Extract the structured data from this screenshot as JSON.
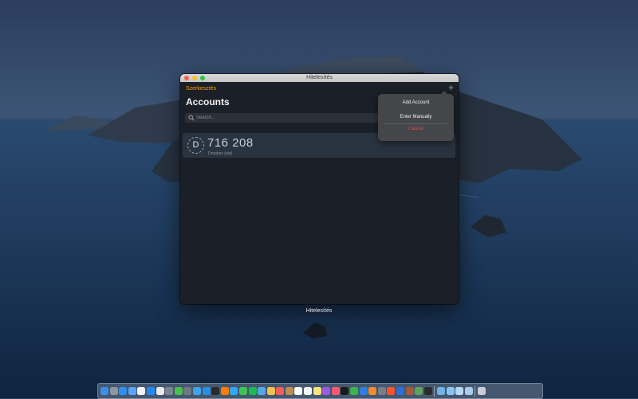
{
  "window": {
    "title": "Hitelesítés",
    "edit_label": "Szerkesztés",
    "add_symbol": "+",
    "heading": "Accounts",
    "search": {
      "placeholder": "Search..."
    },
    "accounts": [
      {
        "initial": "D",
        "code": "716 208",
        "name": "Dropbox (pie)"
      }
    ]
  },
  "popover": {
    "add_account": "Add Account",
    "enter_manually": "Enter Manually",
    "cancel": "Cancel"
  },
  "dock": {
    "hover_label": "Hitelesítés",
    "icons": [
      {
        "name": "finder-icon",
        "color": "#3b8fe8"
      },
      {
        "name": "launchpad-icon",
        "color": "#8d96a3"
      },
      {
        "name": "safari-icon",
        "color": "#2f8ef0"
      },
      {
        "name": "mail-icon",
        "color": "#5aa4f5"
      },
      {
        "name": "calendar-icon",
        "color": "#f2f2f2"
      },
      {
        "name": "app-store-icon",
        "color": "#1f8cf5"
      },
      {
        "name": "chrome-icon",
        "color": "#e9e9e9"
      },
      {
        "name": "system-preferences-icon",
        "color": "#7d8590"
      },
      {
        "name": "messages-green-icon",
        "color": "#48c04f"
      },
      {
        "name": "migration-icon",
        "color": "#6f7884"
      },
      {
        "name": "stickies-icon",
        "color": "#3ea6e8"
      },
      {
        "name": "preview-icon",
        "color": "#2d8de0"
      },
      {
        "name": "terminal-icon",
        "color": "#2a2a2a"
      },
      {
        "name": "illustrator-icon",
        "color": "#ff7c00"
      },
      {
        "name": "photoshop-icon",
        "color": "#31a8ff"
      },
      {
        "name": "facetime-icon",
        "color": "#3dc351"
      },
      {
        "name": "spotify-icon",
        "color": "#1db954"
      },
      {
        "name": "globe-icon",
        "color": "#58a6e6"
      },
      {
        "name": "photos-icon",
        "color": "#f0c14b"
      },
      {
        "name": "tinder-icon",
        "color": "#f05f5a"
      },
      {
        "name": "books-icon",
        "color": "#c28b4f"
      },
      {
        "name": "calendar-date-icon",
        "color": "#fafafa"
      },
      {
        "name": "notes-icon",
        "color": "#f5f5f5"
      },
      {
        "name": "stickies-yellow-icon",
        "color": "#f6e37a"
      },
      {
        "name": "podcasts-icon",
        "color": "#9a5be0"
      },
      {
        "name": "music-icon",
        "color": "#fa5a6e"
      },
      {
        "name": "tv-icon",
        "color": "#1b1b1b"
      },
      {
        "name": "numbers-icon",
        "color": "#39b54a"
      },
      {
        "name": "keynote-icon",
        "color": "#2f7fe0"
      },
      {
        "name": "pages-icon",
        "color": "#f08b2c"
      },
      {
        "name": "screenshot-icon",
        "color": "#7a7f87"
      },
      {
        "name": "brave-icon",
        "color": "#fb542b"
      },
      {
        "name": "authenticator-icon",
        "color": "#2d6fd6"
      },
      {
        "name": "game-icon",
        "color": "#a45b38"
      },
      {
        "name": "chess-icon",
        "color": "#5fa35c"
      },
      {
        "name": "activity-icon",
        "color": "#2b2b2b"
      },
      {
        "name": "folder-icon",
        "color": "#6fb3e8"
      },
      {
        "name": "downloads-folder-icon",
        "color": "#8cc4ee"
      },
      {
        "name": "desktop-folder-icon",
        "color": "#b6d8f2"
      },
      {
        "name": "documents-folder-icon",
        "color": "#a7cdea"
      },
      {
        "name": "trash-icon",
        "color": "#c9ced6"
      }
    ]
  }
}
